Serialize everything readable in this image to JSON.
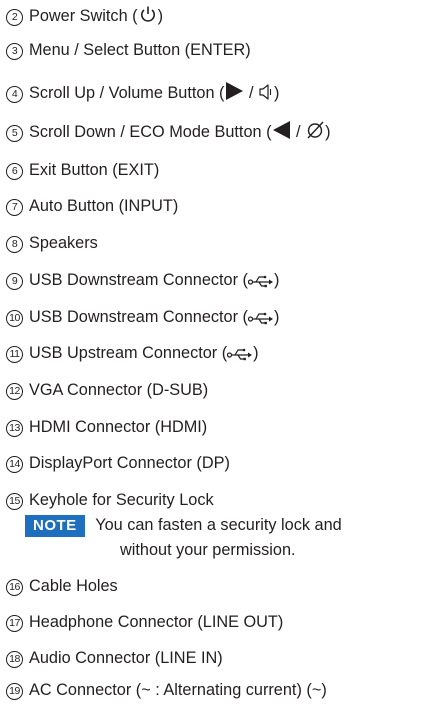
{
  "items": [
    {
      "num": "2",
      "text_a": "Power Switch (",
      "text_b": ")"
    },
    {
      "num": "3",
      "text_a": "Menu / Select Button (ENTER)"
    },
    {
      "num": "4",
      "text_a": "Scroll Up / Volume Button (",
      "mid": " / ",
      "text_b": ")"
    },
    {
      "num": "5",
      "text_a": "Scroll Down / ECO Mode Button (",
      "mid": " / ",
      "text_b": ")"
    },
    {
      "num": "6",
      "text_a": "Exit Button (EXIT)"
    },
    {
      "num": "7",
      "text_a": "Auto Button (INPUT)"
    },
    {
      "num": "8",
      "text_a": "Speakers"
    },
    {
      "num": "9",
      "text_a": "USB Downstream Connector (",
      "text_b": ")"
    },
    {
      "num": "10",
      "text_a": "USB Downstream Connector (",
      "text_b": ")"
    },
    {
      "num": "11",
      "text_a": "USB Upstream Connector (",
      "text_b": ")"
    },
    {
      "num": "12",
      "text_a": "VGA Connector (D-SUB)"
    },
    {
      "num": "13",
      "text_a": "HDMI Connector (HDMI)"
    },
    {
      "num": "14",
      "text_a": "DisplayPort Connector (DP)"
    },
    {
      "num": "15",
      "text_a": "Keyhole for Security Lock"
    },
    {
      "num": "16",
      "text_a": "Cable Holes"
    },
    {
      "num": "17",
      "text_a": "Headphone Connector (LINE OUT)"
    },
    {
      "num": "18",
      "text_a": "Audio Connector (LINE IN)"
    },
    {
      "num": "19",
      "text_a": "AC Connector (",
      "mid": "~",
      "text_b": " : Alternating current) (",
      "end": "~",
      "text_c": ")"
    }
  ],
  "note": {
    "tag": "NOTE",
    "line1": "You can fasten a security lock and",
    "line2": "without your permission."
  },
  "colors": {
    "note_tag_bg": "#1f6fbf",
    "text": "#231f20"
  },
  "icons": [
    "power-icon",
    "right-triangle-icon",
    "speaker-icon",
    "left-triangle-icon",
    "eco-mode-icon",
    "usb-icon",
    "tilde-icon"
  ]
}
